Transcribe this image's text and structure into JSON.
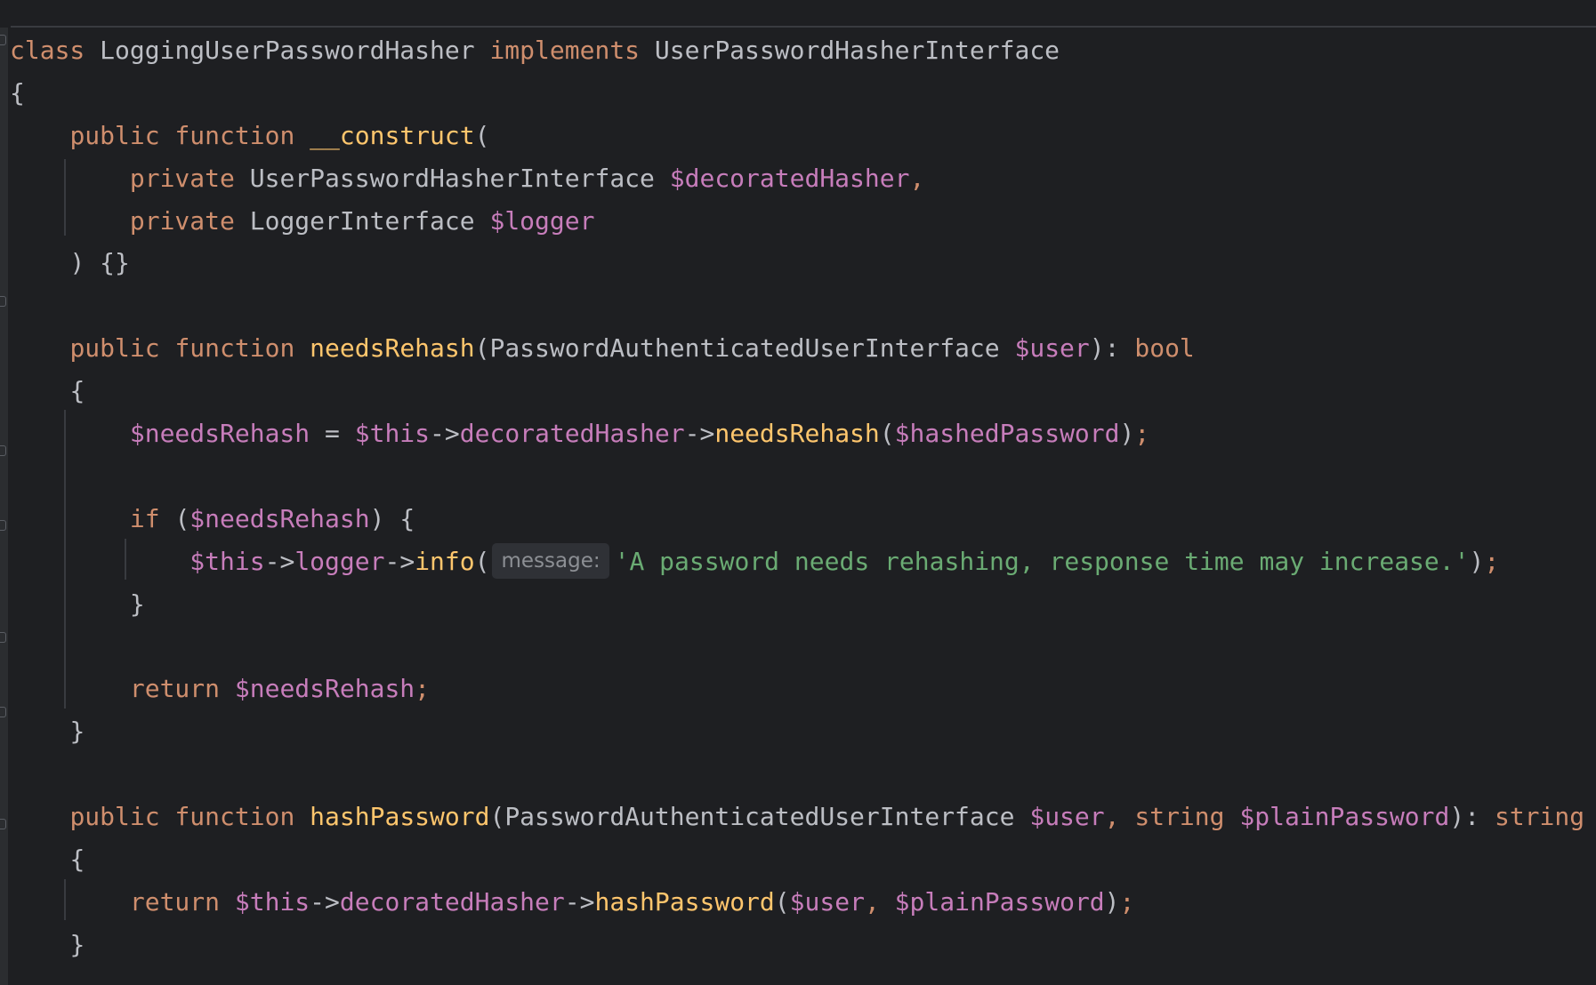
{
  "code": {
    "class_kw": "class",
    "class_name": "LoggingUserPasswordHasher",
    "implements_kw": "implements",
    "interface_name": "UserPasswordHasherInterface",
    "open_brace": "{",
    "close_brace": "}",
    "public_kw": "public",
    "function_kw": "function",
    "private_kw": "private",
    "if_kw": "if",
    "return_kw": "return",
    "bool_type": "bool",
    "string_type": "string",
    "ctor_name": "__construct",
    "ctor_param1_type": "UserPasswordHasherInterface",
    "ctor_param1_var": "$decoratedHasher",
    "ctor_param2_type": "LoggerInterface",
    "ctor_param2_var": "$logger",
    "ctor_close": ") {}",
    "m1_name": "needsRehash",
    "m1_param_type": "PasswordAuthenticatedUserInterface",
    "m1_param_var": "$user",
    "var_needs_rehash": "$needsRehash",
    "this_var": "$this",
    "arrow": "->",
    "prop_decorated": "decoratedHasher",
    "call_needs_rehash": "needsRehash",
    "arg_hashed_password": "$hashedPassword",
    "prop_logger": "logger",
    "call_info": "info",
    "hint_message": "message:",
    "log_string": "'A password needs rehashing, response time may increase.'",
    "m2_name": "hashPassword",
    "m2_param1_type": "PasswordAuthenticatedUserInterface",
    "m2_param1_var": "$user",
    "m2_param2_var": "$plainPassword",
    "call_hash_password": "hashPassword"
  },
  "colors": {
    "background": "#1e1f22",
    "keyword": "#cf8e6d",
    "function": "#ffc66d",
    "variable": "#c77dbb",
    "string": "#6aab73",
    "text": "#bcbec4"
  }
}
